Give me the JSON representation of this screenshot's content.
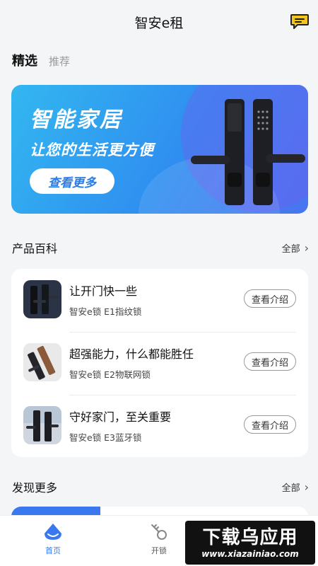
{
  "header": {
    "title": "智安e租",
    "message_icon": "chat-bubble-icon"
  },
  "tabs": {
    "active": "精选",
    "inactive": "推荐"
  },
  "banner": {
    "title": "智能家居",
    "subtitle": "让您的生活更方便",
    "button": "查看更多"
  },
  "encyclopedia": {
    "title": "产品百科",
    "more": "全部",
    "items": [
      {
        "name": "让开门快一些",
        "model": "智安e锁 E1指纹锁",
        "button": "查看介绍"
      },
      {
        "name": "超强能力，什么都能胜任",
        "model": "智安e锁 E2物联网锁",
        "button": "查看介绍"
      },
      {
        "name": "守好家门，至关重要",
        "model": "智安e锁 E3蓝牙锁",
        "button": "查看介绍"
      }
    ]
  },
  "discover": {
    "title": "发现更多",
    "more": "全部",
    "tag": ""
  },
  "tabbar": {
    "items": [
      {
        "label": "首页",
        "icon": "home-icon"
      },
      {
        "label": "开锁",
        "icon": "key-icon"
      }
    ]
  },
  "watermark": {
    "logo": "下载乌应用",
    "url": "www.xiazainiao.com"
  },
  "colors": {
    "accent": "#3a78f0",
    "banner_start": "#33b7f0",
    "banner_end": "#4a74f0"
  }
}
